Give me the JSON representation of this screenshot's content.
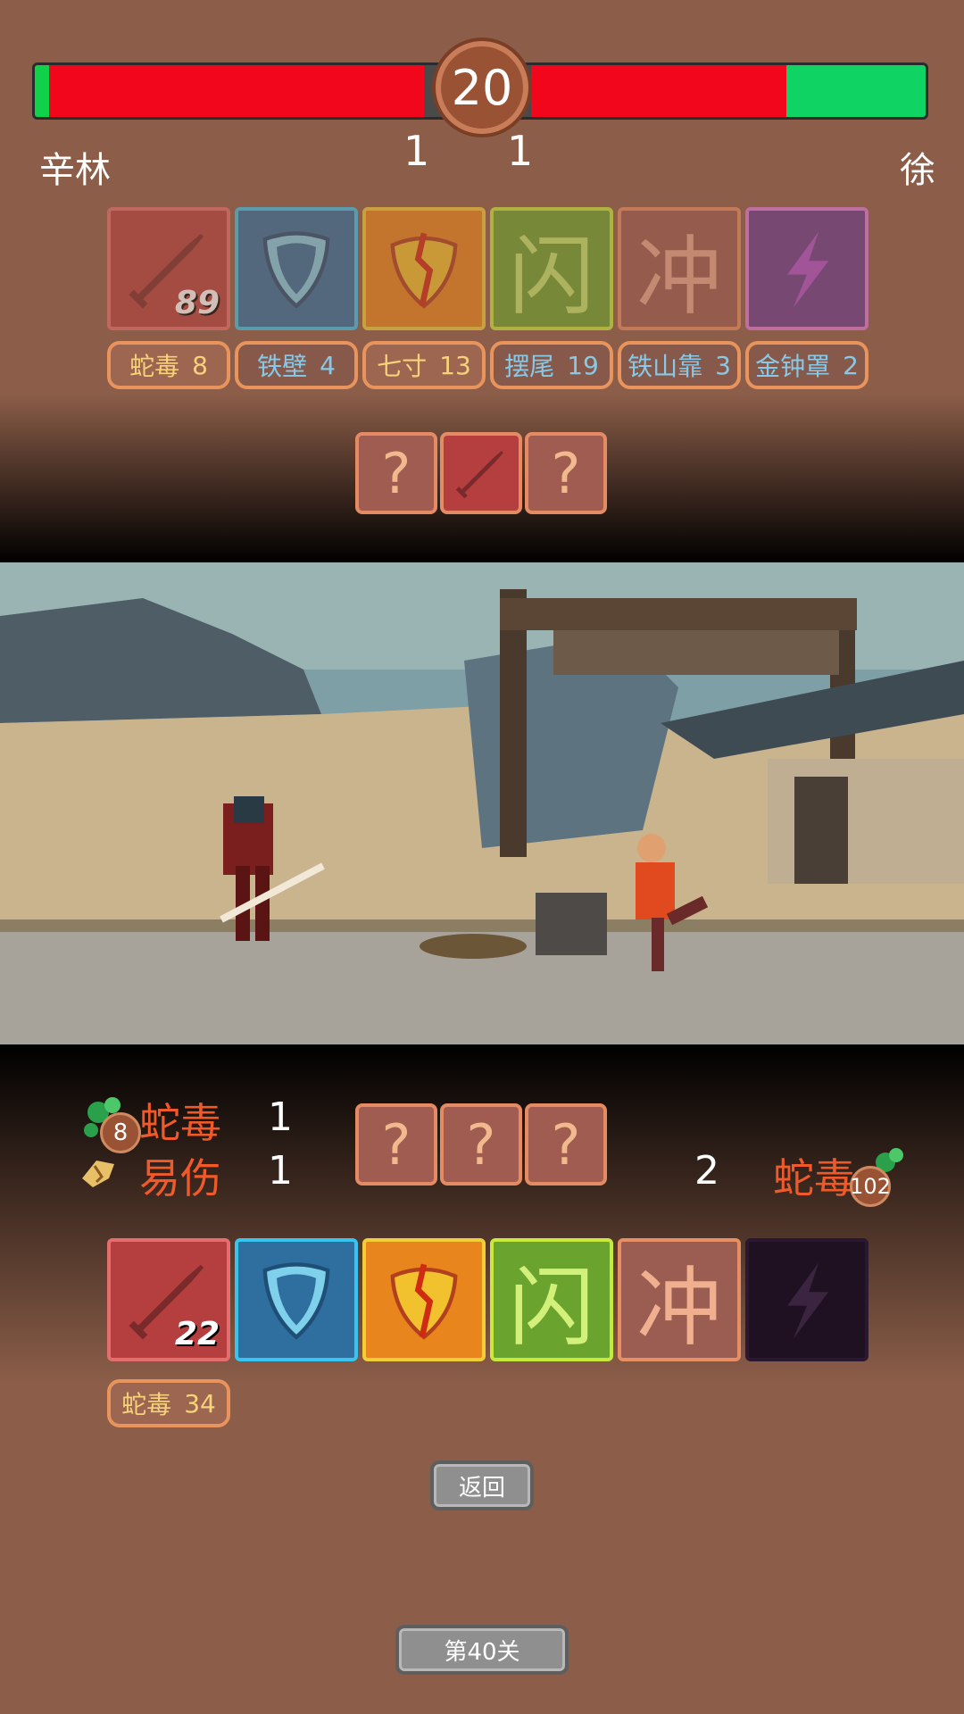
{
  "timer": "20",
  "player": {
    "name": "辛林",
    "score": "1"
  },
  "enemy": {
    "name": "徐",
    "score": "1"
  },
  "hp": {
    "player_fraction": 0.03,
    "enemy_fraction": 0.44
  },
  "enemy_skills": {
    "cards": [
      {
        "icon": "sword-icon",
        "count": "89"
      },
      {
        "icon": "shield-icon"
      },
      {
        "icon": "broken-shield-icon"
      },
      {
        "icon": "dodge-glyph-icon",
        "glyph": "闪"
      },
      {
        "icon": "charge-glyph-icon",
        "glyph": "冲"
      },
      {
        "icon": "lightning-icon"
      }
    ],
    "tags": [
      {
        "label": "蛇毒",
        "value": "8"
      },
      {
        "label": "铁壁",
        "value": "4"
      },
      {
        "label": "七寸",
        "value": "13"
      },
      {
        "label": "摆尾",
        "value": "19"
      },
      {
        "label": "铁山靠",
        "value": "3"
      },
      {
        "label": "金钟罩",
        "value": "2"
      }
    ],
    "queue": [
      "?",
      "sword",
      "?"
    ]
  },
  "player_status": [
    {
      "icon": "poison-icon",
      "badge": "8",
      "label": "蛇毒",
      "value": "1"
    },
    {
      "icon": "fracture-icon",
      "label": "易伤",
      "value": "1"
    }
  ],
  "enemy_status": [
    {
      "icon": "poison-icon",
      "badge": "102",
      "label": "蛇毒",
      "value": "2"
    }
  ],
  "player_queue": [
    "?",
    "?",
    "?"
  ],
  "player_skills": {
    "cards": [
      {
        "icon": "sword-icon",
        "count": "22"
      },
      {
        "icon": "shield-icon"
      },
      {
        "icon": "broken-shield-icon"
      },
      {
        "icon": "dodge-glyph-icon",
        "glyph": "闪"
      },
      {
        "icon": "charge-glyph-icon",
        "glyph": "冲"
      },
      {
        "icon": "lightning-icon",
        "disabled": true
      }
    ],
    "tags": [
      {
        "label": "蛇毒",
        "value": "34"
      }
    ]
  },
  "buttons": {
    "back": "返回",
    "level": "第40关"
  },
  "colors": {
    "hp_red": "#f2061b",
    "hp_green": "#10d24a",
    "status_text": "#f05a2a",
    "tag_text": "#f7d27a"
  }
}
